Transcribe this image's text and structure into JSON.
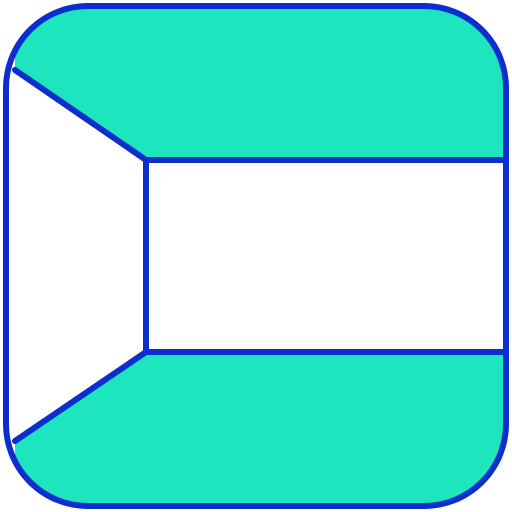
{
  "icon": {
    "name": "kuwait-flag-icon",
    "colors": {
      "outline": "#0B2ECC",
      "band_fill": "#1DE6BF",
      "background": "#FFFFFF"
    }
  }
}
